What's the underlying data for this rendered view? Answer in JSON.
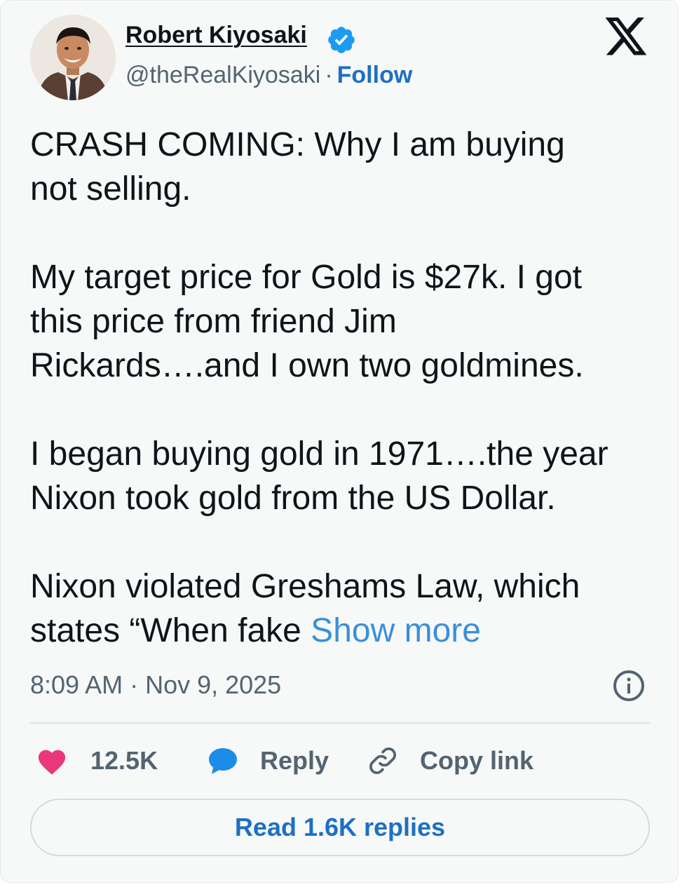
{
  "author": {
    "name": "Robert Kiyosaki",
    "handle": "@theRealKiyosaki",
    "separator": "·",
    "follow_label": "Follow",
    "verified": true,
    "avatar_icon": "profile-photo"
  },
  "brand": {
    "logo": "x-logo-icon"
  },
  "tweet": {
    "paragraphs": [
      [
        "CRASH COMING:  Why I am buying",
        "not selling."
      ],
      [
        "My target price for Gold is $27k.  I got",
        "this price from friend Jim",
        "Rickards….and I own two goldmines."
      ],
      [
        "I began buying gold in 1971….the year",
        "Nixon took gold from the US Dollar."
      ],
      [
        "Nixon violated Greshams Law, which",
        "states “When fake "
      ]
    ],
    "show_more_label": "Show more"
  },
  "meta": {
    "timestamp": "8:09 AM · Nov 9, 2025"
  },
  "actions": {
    "like_count": "12.5K",
    "reply_label": "Reply",
    "copy_link_label": "Copy link"
  },
  "footer": {
    "read_replies_label": "Read 1.6K replies"
  },
  "colors": {
    "background": "#f7f8f8",
    "text": "#0f1419",
    "muted": "#536471",
    "link": "#1d6fc4",
    "show_more": "#3b8fd9",
    "like": "#e8387a",
    "reply_bubble": "#1d8ce8",
    "verified": "#1d9bf0"
  }
}
